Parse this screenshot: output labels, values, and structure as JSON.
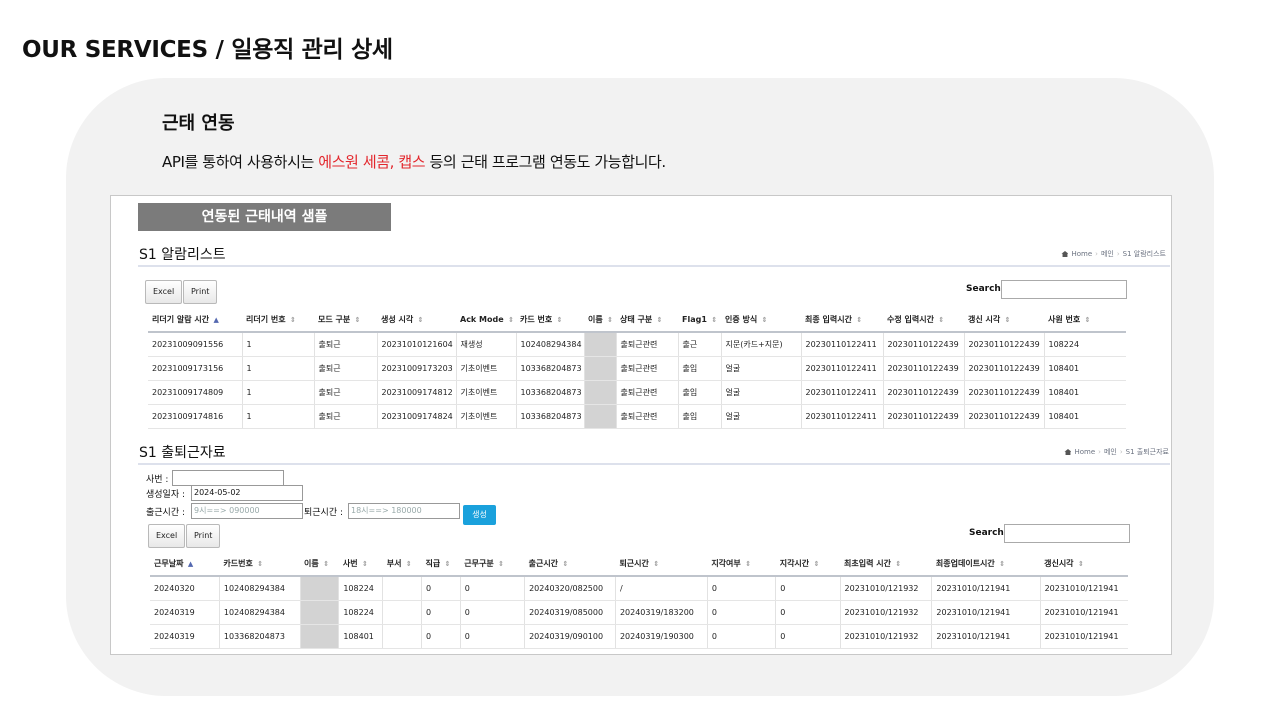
{
  "page_title": "OUR SERVICES / 일용직 관리 상세",
  "section": {
    "title": "근태 연동",
    "desc_before": "API를 통하여 사용하시는 ",
    "desc_highlight": "에스원 세콤, 캡스",
    "desc_after": " 등의 근태 프로그램 연동도 가능합니다."
  },
  "banner": "연동된 근태내역 샘플",
  "colors": {
    "highlight": "#e3262c",
    "banner": "#7b7b7b",
    "generate_button": "#1aa1dc",
    "card": "#f2f2f2"
  },
  "alarm_panel": {
    "title": "S1 알람리스트",
    "breadcrumb": {
      "home": "Home",
      "main": "메인",
      "current": "S1 알람리스트"
    },
    "excel": "Excel",
    "print": "Print",
    "search_label": "Search:",
    "columns": [
      "리더기 알람 시간",
      "리더기 번호",
      "모드 구분",
      "생성 시각",
      "Ack Mode",
      "카드 번호",
      "이름",
      "상태 구분",
      "Flag1",
      "인증 방식",
      "최종 입력시간",
      "수정 입력시간",
      "갱신 시각",
      "사원 번호"
    ],
    "rows": [
      [
        "20231009091556",
        "1",
        "출퇴근",
        "20231010121604",
        "재생성",
        "102408294384",
        "",
        "출퇴근관련",
        "출근",
        "지문(카드+지문)",
        "20230110122411",
        "20230110122439",
        "20230110122439",
        "108224"
      ],
      [
        "20231009173156",
        "1",
        "출퇴근",
        "20231009173203",
        "기초이벤트",
        "103368204873",
        "",
        "출퇴근관련",
        "출입",
        "얼굴",
        "20230110122411",
        "20230110122439",
        "20230110122439",
        "108401"
      ],
      [
        "20231009174809",
        "1",
        "출퇴근",
        "20231009174812",
        "기초이벤트",
        "103368204873",
        "",
        "출퇴근관련",
        "출입",
        "얼굴",
        "20230110122411",
        "20230110122439",
        "20230110122439",
        "108401"
      ],
      [
        "20231009174816",
        "1",
        "출퇴근",
        "20231009174824",
        "기초이벤트",
        "103368204873",
        "",
        "출퇴근관련",
        "출입",
        "얼굴",
        "20230110122411",
        "20230110122439",
        "20230110122439",
        "108401"
      ]
    ]
  },
  "commute_panel": {
    "title": "S1 출퇴근자료",
    "breadcrumb": {
      "home": "Home",
      "main": "메인",
      "current": "S1 출퇴근자료"
    },
    "form": {
      "employee_no_label": "사번 :",
      "employee_no_value": "",
      "created_date_label": "생성일자 :",
      "created_date_value": "2024-05-02",
      "in_time_label": "출근시간 :",
      "in_time_placeholder": "9시==> 090000",
      "out_time_label": "퇴근시간 :",
      "out_time_placeholder": "18시==> 180000",
      "generate": "생성"
    },
    "excel": "Excel",
    "print": "Print",
    "search_label": "Search:",
    "columns": [
      "근무날짜",
      "카드번호",
      "이름",
      "사번",
      "부서",
      "직급",
      "근무구분",
      "출근시간",
      "퇴근시간",
      "지각여부",
      "지각시간",
      "최초입력 시간",
      "최종업데이트시간",
      "갱신시각"
    ],
    "rows": [
      [
        "20240320",
        "102408294384",
        "",
        "108224",
        "",
        "0",
        "0",
        "20240320/082500",
        "/",
        "0",
        "0",
        "20231010/121932",
        "20231010/121941",
        "20231010/121941"
      ],
      [
        "20240319",
        "102408294384",
        "",
        "108224",
        "",
        "0",
        "0",
        "20240319/085000",
        "20240319/183200",
        "0",
        "0",
        "20231010/121932",
        "20231010/121941",
        "20231010/121941"
      ],
      [
        "20240319",
        "103368204873",
        "",
        "108401",
        "",
        "0",
        "0",
        "20240319/090100",
        "20240319/190300",
        "0",
        "0",
        "20231010/121932",
        "20231010/121941",
        "20231010/121941"
      ]
    ]
  }
}
